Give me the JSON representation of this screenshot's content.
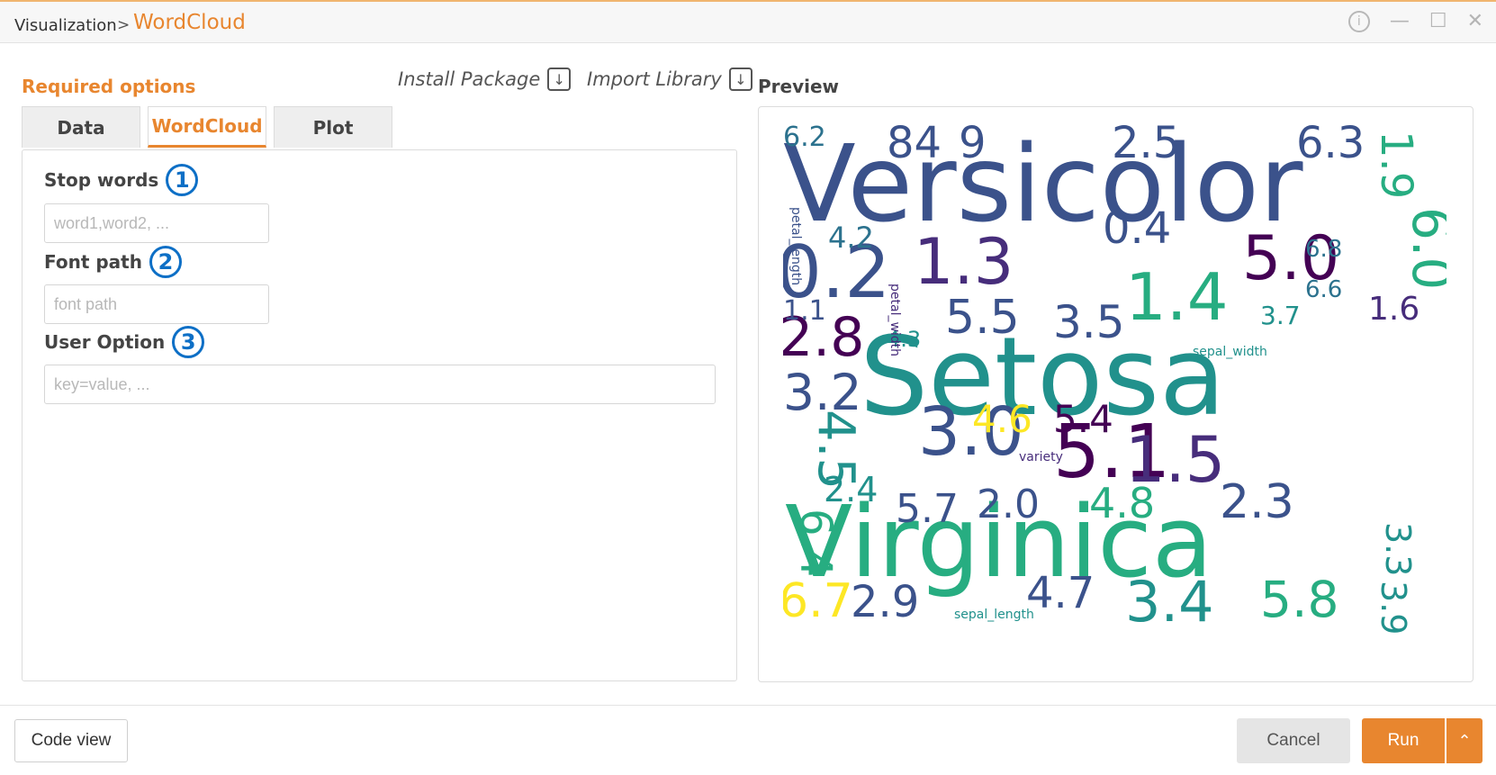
{
  "breadcrumb": {
    "parent": "Visualization",
    "separator": ">",
    "current": "WordCloud"
  },
  "window_icons": [
    "info-icon",
    "minimize-icon",
    "maximize-icon",
    "close-icon"
  ],
  "required_options_label": "Required options",
  "install_package_label": "Install Package",
  "import_library_label": "Import Library",
  "preview_label": "Preview",
  "tabs": [
    {
      "label": "Data",
      "active": false
    },
    {
      "label": "WordCloud",
      "active": true
    },
    {
      "label": "Plot",
      "active": false
    }
  ],
  "fields": {
    "stop_words": {
      "label": "Stop words",
      "badge": "1",
      "placeholder": "word1,word2, ...",
      "value": ""
    },
    "font_path": {
      "label": "Font path",
      "badge": "2",
      "placeholder": "font path",
      "value": ""
    },
    "user_option": {
      "label": "User Option",
      "badge": "3",
      "placeholder": "key=value, ...",
      "value": ""
    }
  },
  "wordcloud": {
    "words": [
      "Versicolor",
      "Setosa",
      "Virginica",
      "0.2",
      "1.3",
      "5.0",
      "6.0",
      "1.4",
      "3.0",
      "5.1",
      "1.5",
      "2.8",
      "3.2",
      "4.5",
      "6.4",
      "6.7",
      "2.9",
      "4.7",
      "3.4",
      "2.3",
      "5.8",
      "6.3",
      "2.5",
      "1.9",
      "6.2",
      "84",
      "9",
      "0.4",
      "5.5",
      "3.5",
      "4.6",
      "5.4",
      "4.8",
      "2.0",
      "5.7",
      "2.4",
      "3.3",
      "3.9",
      "6.8",
      "6.6",
      "3.7",
      "4.2",
      "4.3",
      "1.1",
      "1.6",
      "sepal_width",
      "petal_length",
      "petal_width",
      "sepal_length",
      "variety"
    ],
    "palette": [
      "#440154",
      "#3b528b",
      "#21918c",
      "#5ec962",
      "#fde725",
      "#2c728e",
      "#472d7b",
      "#27ad81",
      "#aadc32"
    ]
  },
  "buttons": {
    "code_view": "Code view",
    "cancel": "Cancel",
    "run": "Run"
  }
}
